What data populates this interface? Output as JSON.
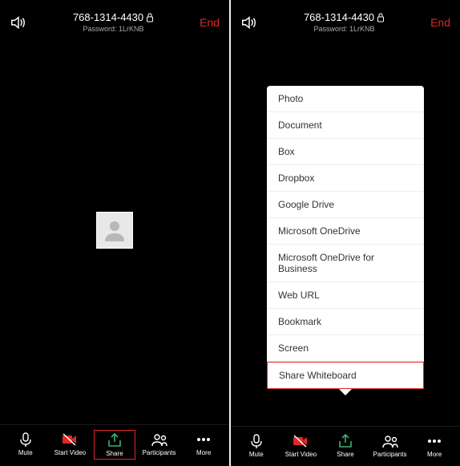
{
  "meeting": {
    "id": "768-1314-4430",
    "password_label": "Password:",
    "password": "1LrKNB",
    "end_label": "End"
  },
  "toolbar": {
    "mute": "Mute",
    "start_video": "Start Video",
    "share": "Share",
    "participants": "Participants",
    "more": "More"
  },
  "share_menu": {
    "items": [
      "Photo",
      "Document",
      "Box",
      "Dropbox",
      "Google Drive",
      "Microsoft OneDrive",
      "Microsoft OneDrive for Business",
      "Web URL",
      "Bookmark",
      "Screen",
      "Share Whiteboard"
    ]
  }
}
